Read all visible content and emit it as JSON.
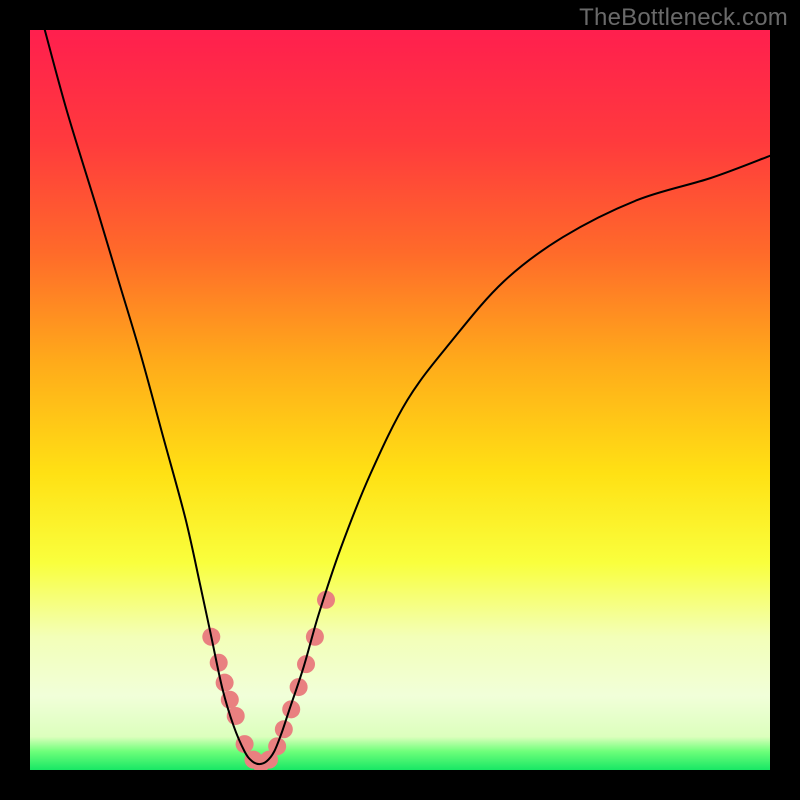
{
  "watermark": "TheBottleneck.com",
  "chart_data": {
    "type": "line",
    "title": "",
    "xlabel": "",
    "ylabel": "",
    "xlim": [
      0,
      100
    ],
    "ylim": [
      0,
      100
    ],
    "grid": false,
    "legend": false,
    "background_gradient_stops": [
      {
        "offset": 0.0,
        "color": "#ff1f4e"
      },
      {
        "offset": 0.15,
        "color": "#ff3a3d"
      },
      {
        "offset": 0.3,
        "color": "#ff6a2a"
      },
      {
        "offset": 0.45,
        "color": "#ffab1a"
      },
      {
        "offset": 0.6,
        "color": "#ffe114"
      },
      {
        "offset": 0.72,
        "color": "#f9ff3d"
      },
      {
        "offset": 0.82,
        "color": "#f3ffb8"
      },
      {
        "offset": 0.9,
        "color": "#f1ffd9"
      },
      {
        "offset": 0.955,
        "color": "#dcffbd"
      },
      {
        "offset": 0.975,
        "color": "#6dff7a"
      },
      {
        "offset": 1.0,
        "color": "#18e765"
      }
    ],
    "series": [
      {
        "name": "bottleneck-curve",
        "color": "#000000",
        "stroke_width": 2,
        "x": [
          2,
          5,
          9,
          12,
          15,
          18,
          21,
          23,
          24.5,
          26,
          27.5,
          29,
          30,
          31,
          32,
          33,
          34,
          35,
          37,
          39,
          42,
          46,
          51,
          57,
          64,
          72,
          82,
          92,
          100
        ],
        "y": [
          100,
          89,
          76,
          66,
          56,
          45,
          34,
          25,
          18,
          11,
          6,
          2.5,
          1.2,
          0.8,
          1.2,
          2.5,
          5,
          8,
          14,
          21,
          30,
          40,
          50,
          58,
          66,
          72,
          77,
          80,
          83
        ]
      }
    ],
    "markers": {
      "name": "data-points",
      "color": "#e98080",
      "radius": 9,
      "x": [
        24.5,
        25.5,
        26.3,
        27,
        27.8,
        29,
        30.2,
        31.2,
        32.3,
        33.4,
        34.3,
        35.3,
        36.3,
        37.3,
        38.5,
        40
      ],
      "y": [
        18,
        14.5,
        11.8,
        9.5,
        7.3,
        3.5,
        1.4,
        0.9,
        1.4,
        3.2,
        5.5,
        8.2,
        11.2,
        14.3,
        18,
        23
      ]
    }
  }
}
